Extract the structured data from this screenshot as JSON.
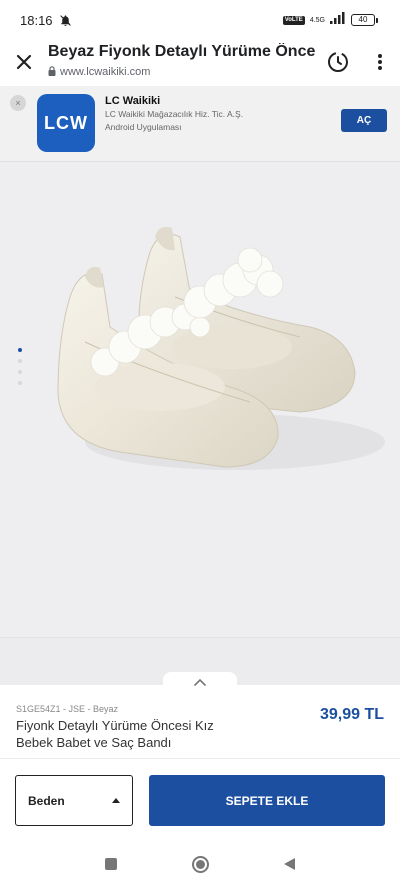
{
  "status_bar": {
    "time": "18:16",
    "network": "4.5G",
    "volte": "VoLTE",
    "battery": "40"
  },
  "browser": {
    "title": "Beyaz Fiyonk Detaylı Yürüme Öncesi",
    "url": "www.lcwaikiki.com"
  },
  "app_banner": {
    "close": "×",
    "icon_text": "LCW",
    "app_name": "LC Waikiki",
    "company": "LC Waikiki Mağazacılık Hiz. Tic. A.Ş.",
    "app_type": "Android Uygulaması",
    "open_label": "AÇ"
  },
  "gallery": {
    "image": "white satin baby ballerina shoes with flower strap",
    "image_count": 4,
    "active_index": 0
  },
  "product": {
    "sku": "S1GE54Z1 - JSE - Beyaz",
    "name": "Fiyonk Detaylı Yürüme Öncesi Kız Bebek Babet ve Saç Bandı",
    "price": "39,99 TL"
  },
  "actions": {
    "size_label": "Beden",
    "add_to_cart_label": "SEPETE EKLE"
  },
  "colors": {
    "brand_blue": "#1d4fa0",
    "app_icon_blue": "#1d5fbf",
    "gallery_bg": "#eeeef0"
  },
  "icons": {
    "close": "close-icon",
    "lock": "lock-icon",
    "history": "history-icon",
    "menu": "more-vert-icon",
    "mute": "bell-off-icon",
    "signal": "signal-icon",
    "expand": "chevron-up-icon",
    "dropdown": "caret-up-icon"
  }
}
